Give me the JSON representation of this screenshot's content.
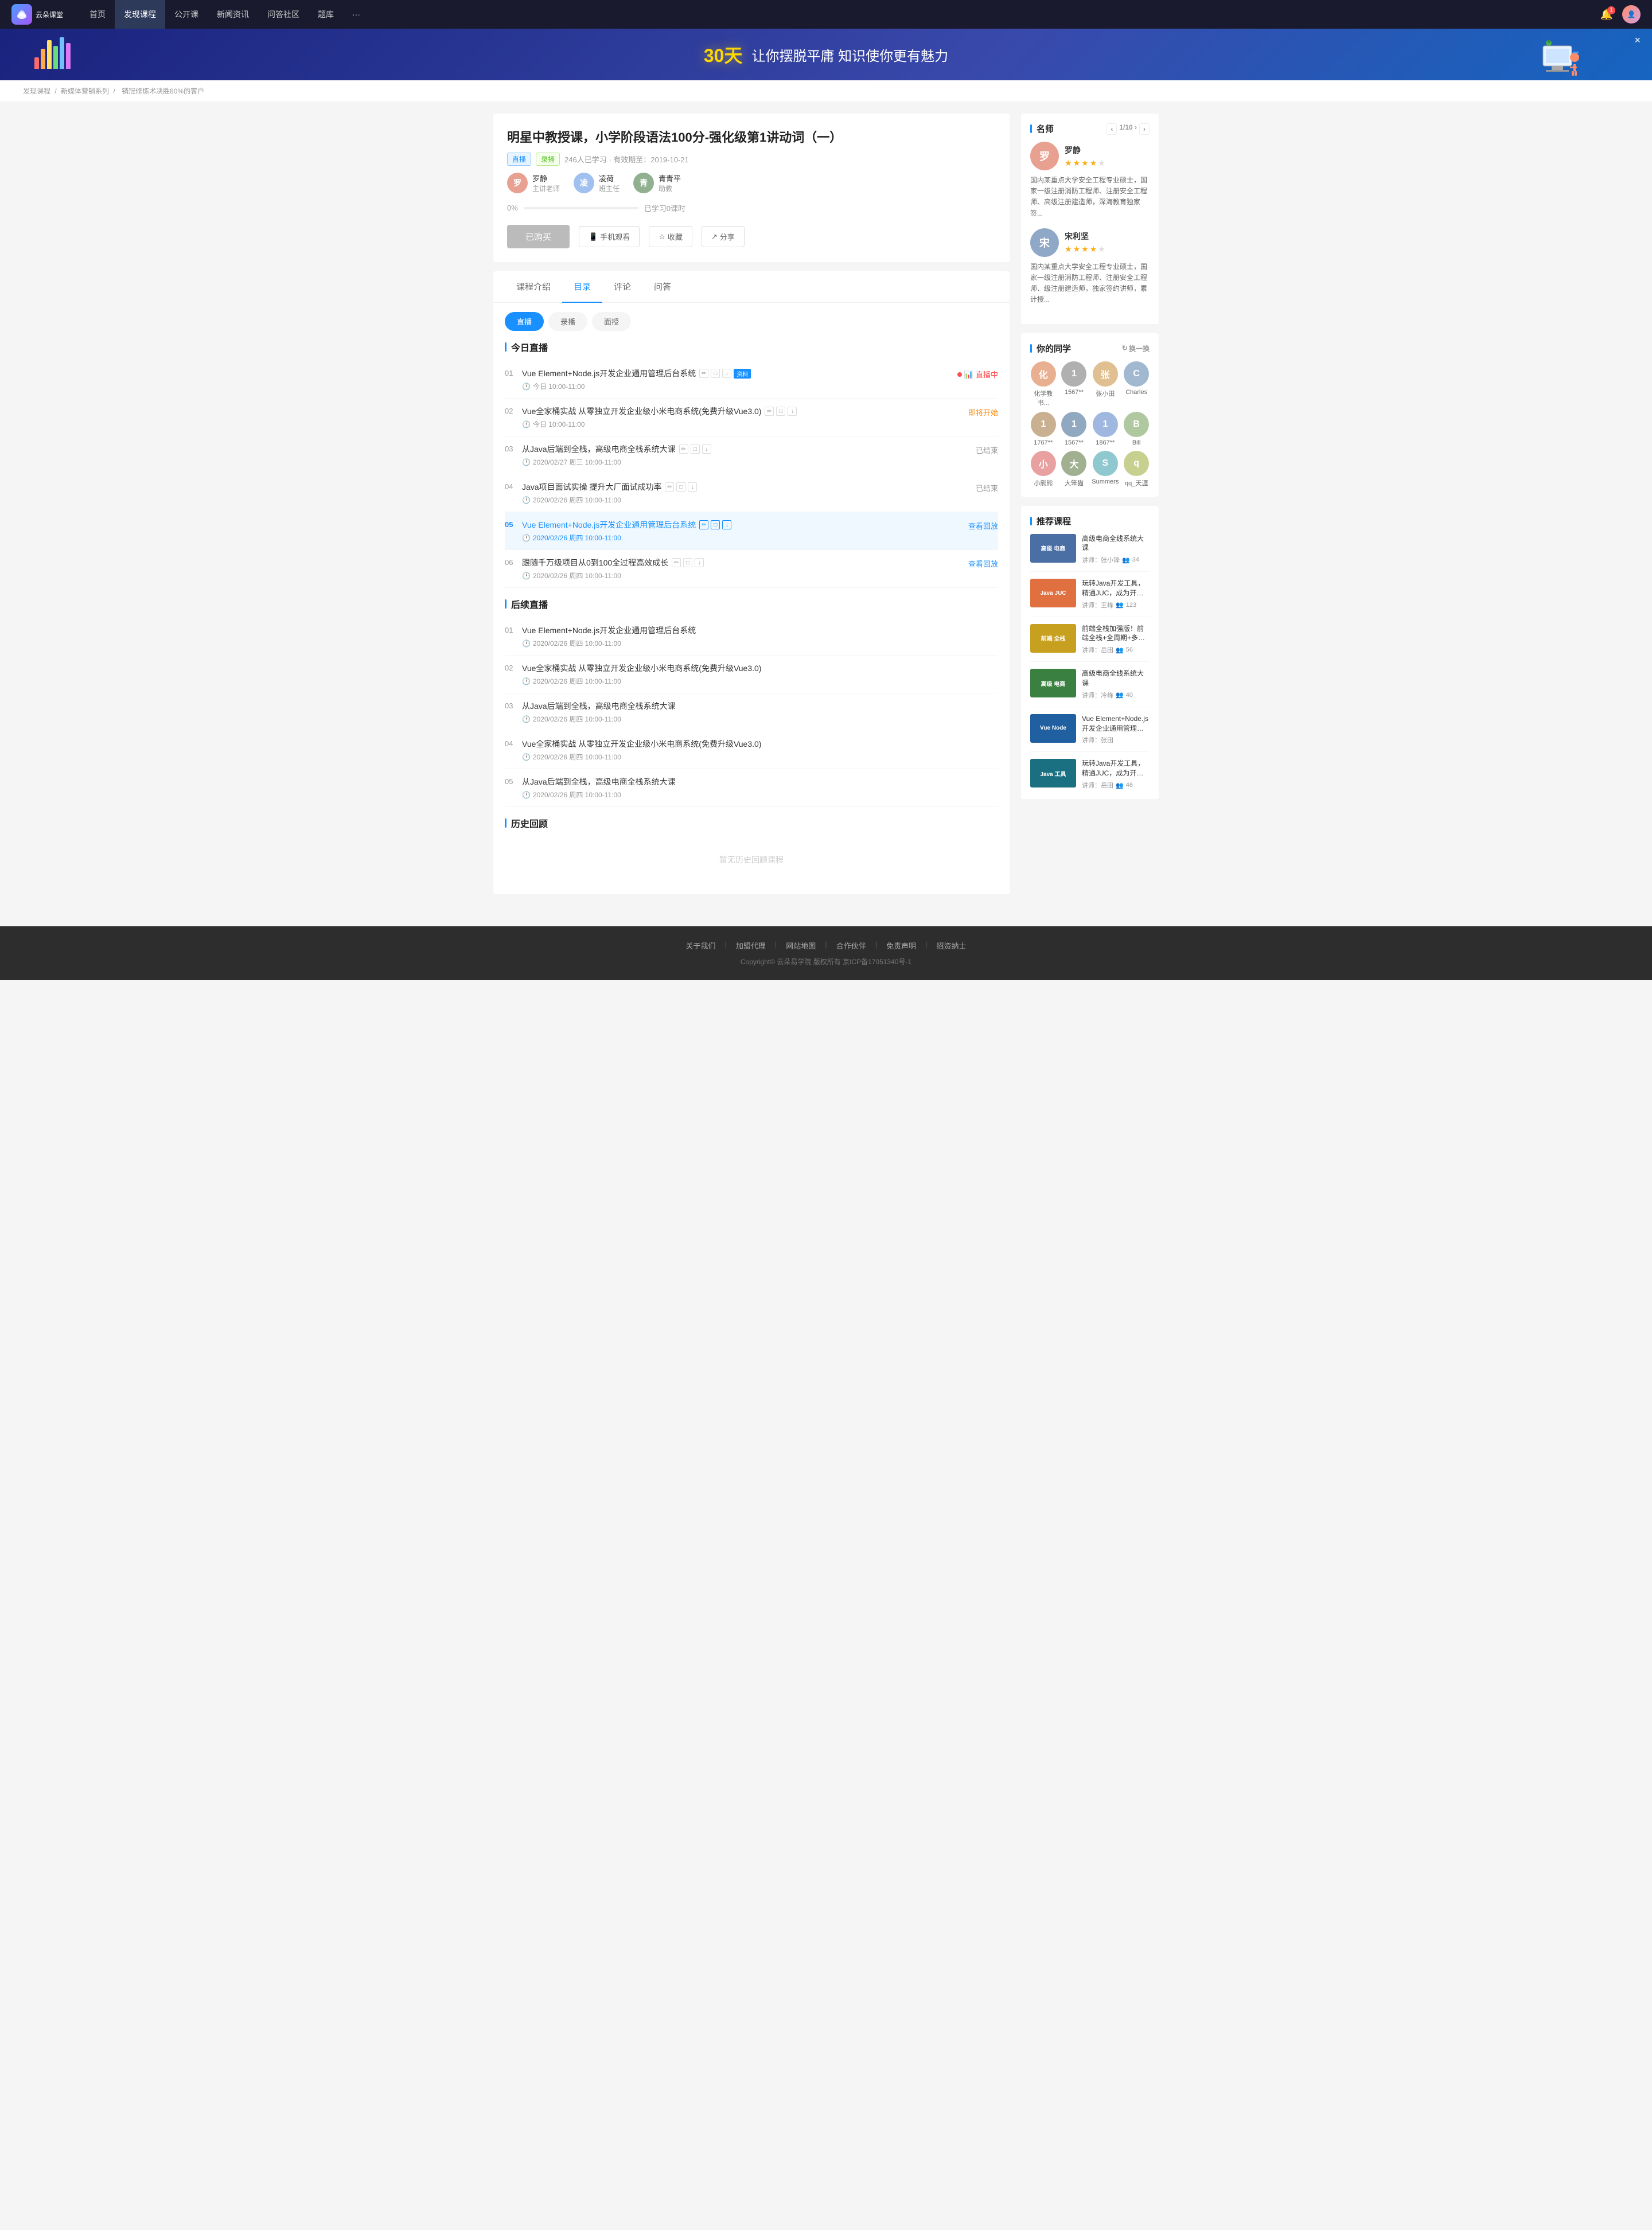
{
  "nav": {
    "logo_text": "云朵课堂",
    "items": [
      {
        "label": "首页",
        "active": false
      },
      {
        "label": "发现课程",
        "active": true
      },
      {
        "label": "公开课",
        "active": false
      },
      {
        "label": "新闻资讯",
        "active": false
      },
      {
        "label": "问答社区",
        "active": false
      },
      {
        "label": "题库",
        "active": false
      },
      {
        "label": "···",
        "active": false
      }
    ]
  },
  "banner": {
    "highlight": "30天",
    "text": "让你摆脱平庸  知识使你更有魅力",
    "close_label": "×"
  },
  "breadcrumb": {
    "items": [
      "发现课程",
      "新媒体营销系列",
      "销冠修炼术决胜80%的客户"
    ]
  },
  "course": {
    "title": "明星中教授课，小学阶段语法100分-强化级第1讲动词（一）",
    "tags": [
      "直播",
      "录播"
    ],
    "info": "246人已学习 · 有效期至：2019-10-21",
    "teachers": [
      {
        "name": "罗静",
        "role": "主讲老师",
        "bg": "#f0a080"
      },
      {
        "name": "凌荷",
        "role": "班主任",
        "bg": "#a0c0f0"
      },
      {
        "name": "青青平",
        "role": "助教",
        "bg": "#90b090"
      }
    ],
    "progress": {
      "pct": 0,
      "label": "0%",
      "sub": "已学习0课时"
    },
    "btn_buy": "已购买",
    "btn_mobile": "手机观看",
    "btn_collect": "收藏",
    "btn_share": "分享"
  },
  "tabs": {
    "items": [
      "课程介绍",
      "目录",
      "评论",
      "问答"
    ],
    "active": 1
  },
  "subtabs": {
    "items": [
      "直播",
      "录播",
      "面授"
    ],
    "active": 0
  },
  "today_live": {
    "title": "今日直播",
    "lessons": [
      {
        "num": "01",
        "title": "Vue Element+Node.js开发企业通用管理后台系统",
        "has_icons": true,
        "has_resource": true,
        "resource_label": "资料",
        "time": "今日 10:00-11:00",
        "status": "直播中",
        "status_type": "live"
      },
      {
        "num": "02",
        "title": "Vue全家桶实战 从零独立开发企业级小米电商系统(免费升级Vue3.0)",
        "has_icons": true,
        "has_resource": false,
        "time": "今日 10:00-11:00",
        "status": "即将开始",
        "status_type": "soon"
      },
      {
        "num": "03",
        "title": "从Java后端到全栈，高级电商全栈系统大课",
        "has_icons": true,
        "has_resource": false,
        "time": "2020/02/27 周三 10:00-11:00",
        "status": "已结束",
        "status_type": "ended"
      },
      {
        "num": "04",
        "title": "Java项目面试实操 提升大厂面试成功率",
        "has_icons": true,
        "has_resource": false,
        "time": "2020/02/26 周四 10:00-11:00",
        "status": "已结束",
        "status_type": "ended"
      },
      {
        "num": "05",
        "title": "Vue Element+Node.js开发企业通用管理后台系统",
        "has_icons": true,
        "has_resource": false,
        "time": "2020/02/26 周四 10:00-11:00",
        "status": "查看回放",
        "status_type": "replay",
        "active": true
      },
      {
        "num": "06",
        "title": "跟随千万级项目从0到100全过程高效成长",
        "has_icons": true,
        "has_resource": false,
        "time": "2020/02/26 周四 10:00-11:00",
        "status": "查看回放",
        "status_type": "replay"
      }
    ]
  },
  "upcoming_live": {
    "title": "后续直播",
    "lessons": [
      {
        "num": "01",
        "title": "Vue Element+Node.js开发企业通用管理后台系统",
        "time": "2020/02/26 周四 10:00-11:00"
      },
      {
        "num": "02",
        "title": "Vue全家桶实战 从零独立开发企业级小米电商系统(免费升级Vue3.0)",
        "time": "2020/02/26 周四 10:00-11:00"
      },
      {
        "num": "03",
        "title": "从Java后端到全栈，高级电商全栈系统大课",
        "time": "2020/02/26 周四 10:00-11:00"
      },
      {
        "num": "04",
        "title": "Vue全家桶实战 从零独立开发企业级小米电商系统(免费升级Vue3.0)",
        "time": "2020/02/26 周四 10:00-11:00"
      },
      {
        "num": "05",
        "title": "从Java后端到全栈，高级电商全栈系统大课",
        "time": "2020/02/26 周四 10:00-11:00"
      }
    ]
  },
  "history": {
    "title": "历史回顾",
    "empty_msg": "暂无历史回顾课程"
  },
  "sidebar": {
    "teachers_title": "名师",
    "teachers_nav": "1/10 ›",
    "teachers": [
      {
        "name": "罗静",
        "stars": 4,
        "bio": "国内某重点大学安全工程专业硕士，国家一级注册消防工程师、注册安全工程师、高级注册建造师，深海教育独家签...",
        "bg": "#e8a090"
      },
      {
        "name": "宋利坚",
        "stars": 4,
        "bio": "国内某重点大学安全工程专业硕士，国家一级注册消防工程师、注册安全工程师、级注册建造师，独家签约讲师，累计授...",
        "bg": "#90a8c8"
      }
    ],
    "classmates_title": "你的同学",
    "refresh_label": "换一换",
    "classmates": [
      {
        "name": "化学教书...",
        "bg": "#e8b090"
      },
      {
        "name": "1567**",
        "bg": "#b0b0b0"
      },
      {
        "name": "张小田",
        "bg": "#e0c090"
      },
      {
        "name": "Charles",
        "bg": "#a0b8d0"
      },
      {
        "name": "1767**",
        "bg": "#c8b090"
      },
      {
        "name": "1567**",
        "bg": "#90a8c0"
      },
      {
        "name": "1867**",
        "bg": "#a0b8e0"
      },
      {
        "name": "Bill",
        "bg": "#b0c8a0"
      },
      {
        "name": "小熊熊",
        "bg": "#e8a0a0"
      },
      {
        "name": "大笨猫",
        "bg": "#a0b090"
      },
      {
        "name": "Summers",
        "bg": "#90c8d0"
      },
      {
        "name": "qq_天涯",
        "bg": "#c8d090"
      }
    ],
    "rec_title": "推荐课程",
    "rec_courses": [
      {
        "title": "高级电商全线系统大课",
        "teacher": "讲师：张小锋",
        "students": "34",
        "bg": "#4a6fa5",
        "thumb_text": "高级\n电商"
      },
      {
        "title": "玩转Java开发工具，精通JUC，成为开发多面手",
        "teacher": "讲师：王峰",
        "students": "123",
        "bg": "#e07040",
        "thumb_text": "Java\nJUC"
      },
      {
        "title": "前端全栈加强版！前端全栈+全周期+多维应用",
        "teacher": "讲师：岳田",
        "students": "56",
        "bg": "#c8a020",
        "thumb_text": "前端\n全栈"
      },
      {
        "title": "高级电商全线系统大课",
        "teacher": "讲师：冷峰",
        "students": "40",
        "bg": "#3a8040",
        "thumb_text": "高级\n电商"
      },
      {
        "title": "Vue Element+Node.js开发企业通用管理后台系统",
        "teacher": "讲师：张田",
        "students": "",
        "bg": "#2060a0",
        "thumb_text": "Vue\nNode"
      },
      {
        "title": "玩转Java开发工具，精通JUC，成为开发多面手",
        "teacher": "讲师：岳田",
        "students": "46",
        "bg": "#1a7080",
        "thumb_text": "Java\n工具"
      }
    ]
  },
  "footer": {
    "links": [
      "关于我们",
      "加盟代理",
      "网站地图",
      "合作伙伴",
      "免责声明",
      "招资纳士"
    ],
    "copyright": "Copyright© 云朵易学院  版权所有  京ICP备17051340号-1"
  }
}
